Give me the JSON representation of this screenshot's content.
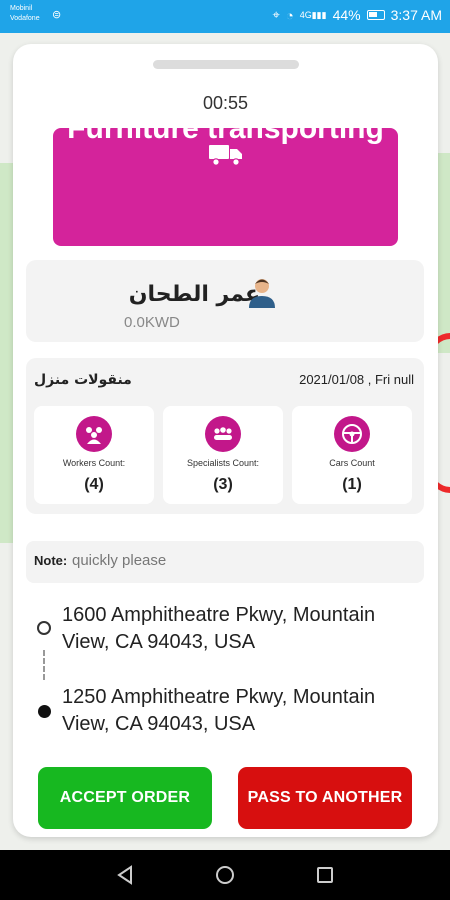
{
  "status_bar": {
    "carrier_line1": "Mobinil",
    "carrier_line2": "Vodafone",
    "signal_text": "4G",
    "battery": "44%",
    "time": "3:37 AM"
  },
  "order": {
    "timer": "00:55",
    "service_title": "Furniture transporting",
    "client_name": "عمر الطحان",
    "client_price": "0.0KWD",
    "order_type": "منقولات منزل",
    "order_date": "2021/01/08 , Fri null",
    "counts": [
      {
        "label": "Workers Count:",
        "value": "(4)",
        "icon": "workers-icon"
      },
      {
        "label": "Specialists Count:",
        "value": "(3)",
        "icon": "specialists-icon"
      },
      {
        "label": "Cars Count",
        "value": "(1)",
        "icon": "steering-wheel-icon"
      }
    ],
    "note_label": "Note:",
    "note_text": "quickly please",
    "pickup_address": "1600 Amphitheatre Pkwy, Mountain View, CA 94043, USA",
    "dropoff_address": "1250 Amphitheatre Pkwy, Mountain View, CA 94043, USA"
  },
  "actions": {
    "accept_label": "ACCEPT ORDER",
    "pass_label": "PASS TO ANOTHER"
  },
  "colors": {
    "status_bar": "#1fa4e8",
    "brand_magenta": "#d4239b",
    "accept_green": "#17b820",
    "pass_red": "#d70f0f"
  }
}
